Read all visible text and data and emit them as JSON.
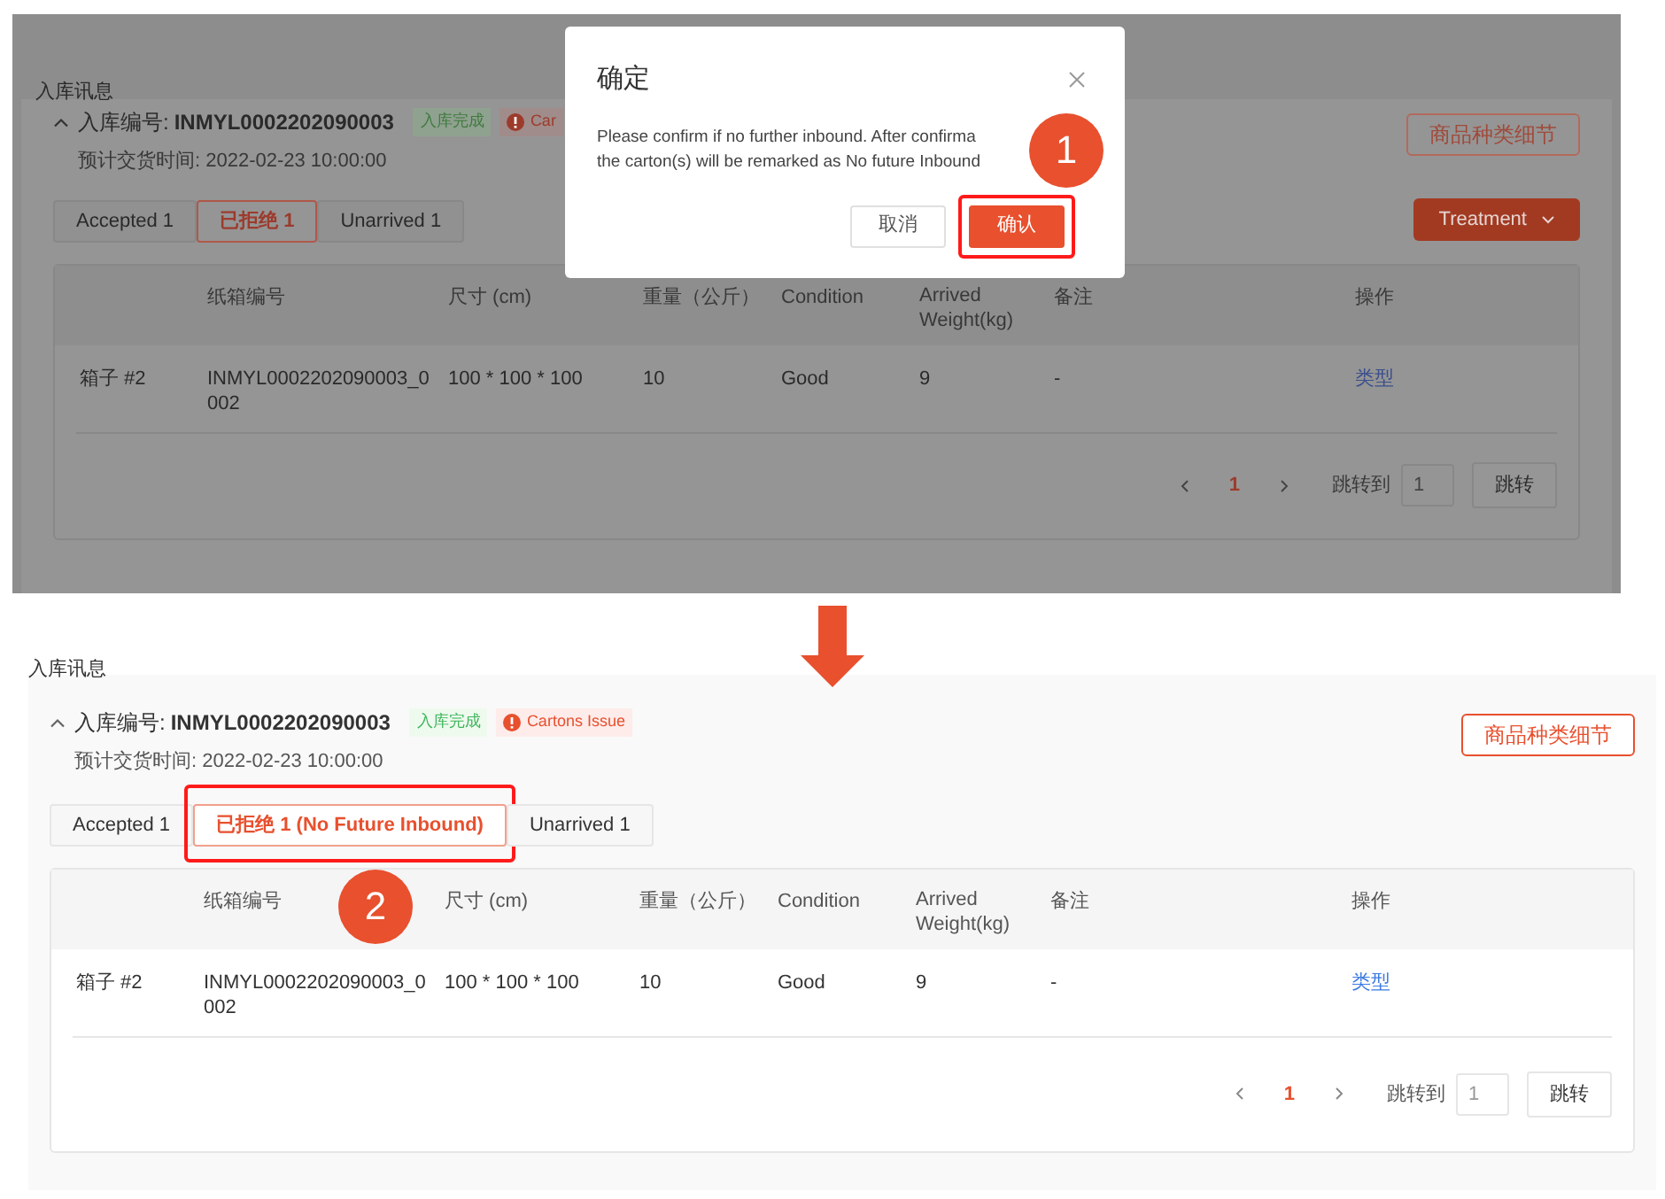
{
  "before": {
    "section_title": "入库讯息",
    "inbound_label": "入库编号:",
    "inbound_no": "INMYL0002202090003",
    "status_badge": "入库完成",
    "issue_badge": "Car",
    "eta": "预计交货时间: 2022-02-23 10:00:00",
    "detail_button": "商品种类细节",
    "tabs": [
      {
        "label": "Accepted 1",
        "selected": false,
        "highlighted": false
      },
      {
        "label": "已拒绝 1",
        "selected": true,
        "highlighted": false
      },
      {
        "label": "Unarrived 1",
        "selected": false,
        "highlighted": false
      }
    ],
    "treatment_button": "Treatment",
    "table": {
      "columns": [
        "纸箱编号",
        "尺寸 (cm)",
        "重量（公斤）",
        "Condition",
        "Arrived Weight(kg)",
        "备注",
        "操作"
      ],
      "rows": [
        {
          "name": "箱子 #2",
          "cells": [
            "INMYL0002202090003_0002",
            "100 * 100 * 100",
            "10",
            "Good",
            "9",
            "-",
            "类型"
          ]
        }
      ]
    },
    "pagination": {
      "pages": [
        {
          "label": "1",
          "selected": true
        }
      ],
      "jump_label": "跳转到",
      "jump_value": "1",
      "go_button": "跳转"
    },
    "dialog": {
      "title": "确定",
      "message_lines": [
        "Please confirm if no further inbound. After confirma",
        "the carton(s) will be remarked as No future Inbound"
      ],
      "buttons": [
        {
          "label": "取消",
          "kind": "secondary",
          "highlighted": false
        },
        {
          "label": "确认",
          "kind": "primary",
          "highlighted": true,
          "callout": "1"
        }
      ]
    }
  },
  "after": {
    "section_title": "入库讯息",
    "inbound_label": "入库编号:",
    "inbound_no": "INMYL0002202090003",
    "status_badge": "入库完成",
    "issue_badge": "Cartons Issue",
    "eta": "预计交货时间: 2022-02-23 10:00:00",
    "detail_button": "商品种类细节",
    "tabs": [
      {
        "label": "Accepted 1",
        "selected": false,
        "highlighted": false
      },
      {
        "label": "已拒绝 1 (No Future Inbound)",
        "selected": true,
        "highlighted": true,
        "callout": "2"
      },
      {
        "label": "Unarrived 1",
        "selected": false,
        "highlighted": false
      }
    ],
    "table": {
      "columns": [
        "纸箱编号",
        "尺寸 (cm)",
        "重量（公斤）",
        "Condition",
        "Arrived Weight(kg)",
        "备注",
        "操作"
      ],
      "rows": [
        {
          "name": "箱子 #2",
          "cells": [
            "INMYL0002202090003_0002",
            "100 * 100 * 100",
            "10",
            "Good",
            "9",
            "-",
            "类型"
          ]
        }
      ]
    },
    "pagination": {
      "pages": [
        {
          "label": "1",
          "selected": true
        }
      ],
      "jump_label": "跳转到",
      "jump_value": "1",
      "go_button": "跳转"
    }
  }
}
